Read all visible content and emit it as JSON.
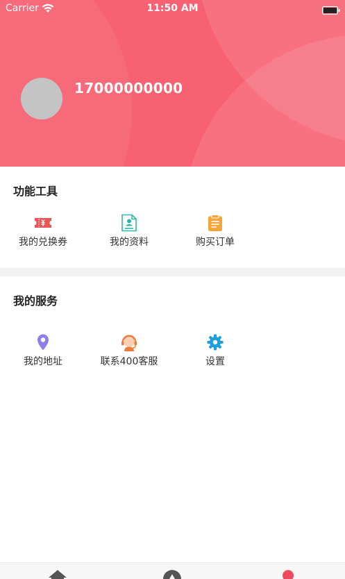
{
  "status_bar": {
    "carrier": "Carrier",
    "time": "11:50 AM"
  },
  "profile": {
    "phone": "17000000000"
  },
  "tools": {
    "title": "功能工具",
    "items": [
      {
        "label": "我的兑换券",
        "icon": "coupon-icon"
      },
      {
        "label": "我的资料",
        "icon": "profile-document-icon"
      },
      {
        "label": "购买订单",
        "icon": "order-clipboard-icon"
      }
    ]
  },
  "services": {
    "title": "我的服务",
    "items": [
      {
        "label": "我的地址",
        "icon": "location-pin-icon"
      },
      {
        "label": "联系400客服",
        "icon": "customer-service-icon"
      },
      {
        "label": "设置",
        "icon": "gear-icon"
      }
    ]
  },
  "colors": {
    "header": "#f76172",
    "coupon": "#e85658",
    "profile": "#2bb7a8",
    "order": "#f5a63a",
    "location": "#8c7fe8",
    "service": "#f07a3a",
    "settings": "#1e9de0",
    "active_tab": "#f04a5e"
  },
  "tabbar": {
    "tabs": [
      {
        "icon": "home-icon",
        "active": false
      },
      {
        "icon": "discover-icon",
        "active": false
      },
      {
        "icon": "mine-icon",
        "active": true
      }
    ]
  }
}
